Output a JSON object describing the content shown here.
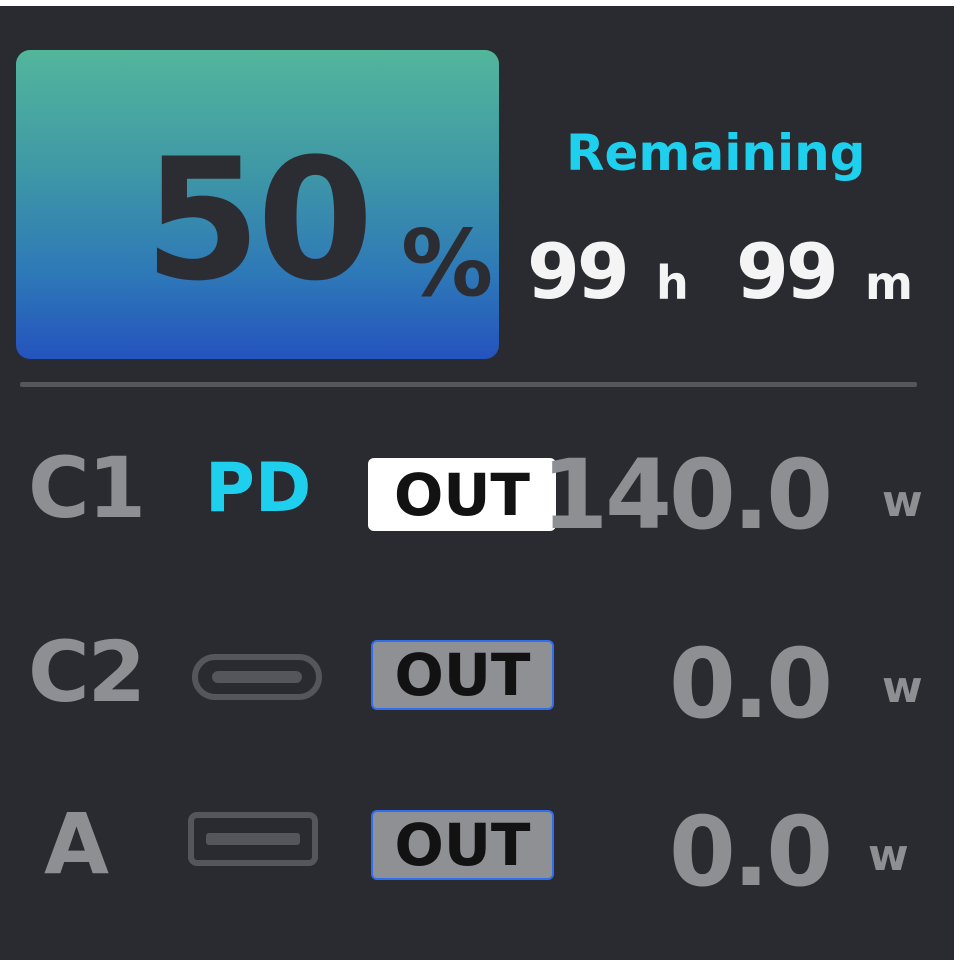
{
  "battery": {
    "percent": "50",
    "unit": "%",
    "remaining_label": "Remaining",
    "hours": "99",
    "hours_unit": "h",
    "minutes": "99",
    "minutes_unit": "m",
    "gradient_top": "#52b69c",
    "gradient_bottom": "#2453bd"
  },
  "ports": [
    {
      "name": "C1",
      "protocol": "PD",
      "direction": "OUT",
      "active": true,
      "power": "140.0",
      "power_unit": "w"
    },
    {
      "name": "C2",
      "icon": "usb-c-port-icon",
      "direction": "OUT",
      "active": false,
      "power": "0.0",
      "power_unit": "w"
    },
    {
      "name": "A",
      "icon": "usb-a-port-icon",
      "direction": "OUT",
      "active": false,
      "power": "0.0",
      "power_unit": "w"
    }
  ],
  "colors": {
    "background": "#2a2b30",
    "accent": "#1fd0ee",
    "muted_text": "#8e8f93",
    "inactive_badge_border": "#2f6ef0"
  }
}
